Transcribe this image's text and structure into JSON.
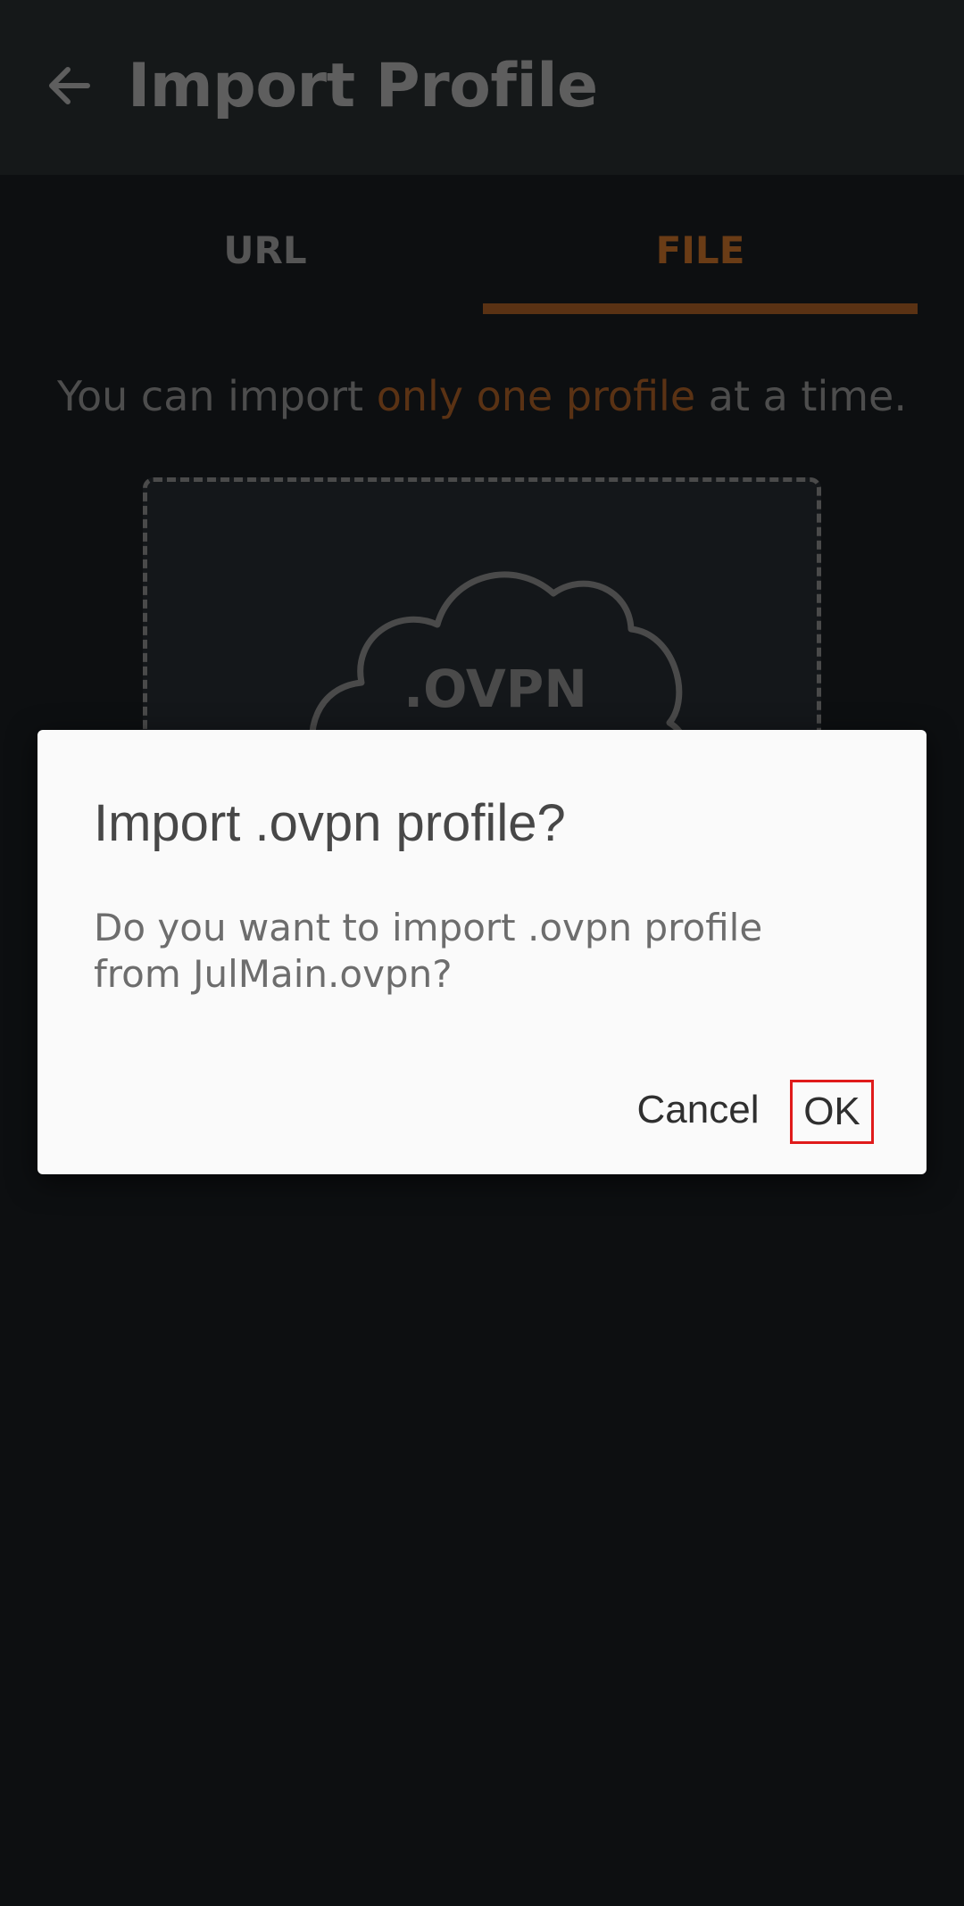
{
  "app_bar": {
    "back_icon": "arrow-left-icon",
    "title": "Import Profile"
  },
  "tabs": [
    {
      "label": "URL",
      "selected": false
    },
    {
      "label": "FILE",
      "selected": true
    }
  ],
  "info": {
    "prefix": "You can import ",
    "highlight": "only one profile",
    "suffix": " at a time."
  },
  "drop_zone": {
    "icon": "cloud-icon",
    "label": ".OVPN"
  },
  "dialog": {
    "title": "Import .ovpn profile?",
    "message": "Do you want to import .ovpn profile from JulMain.ovpn?",
    "cancel_label": "Cancel",
    "ok_label": "OK"
  },
  "colors": {
    "accent": "#5a3214",
    "background": "#0d0f11",
    "dialog_bg": "#fafafa",
    "highlight_border": "#e01b1b"
  }
}
